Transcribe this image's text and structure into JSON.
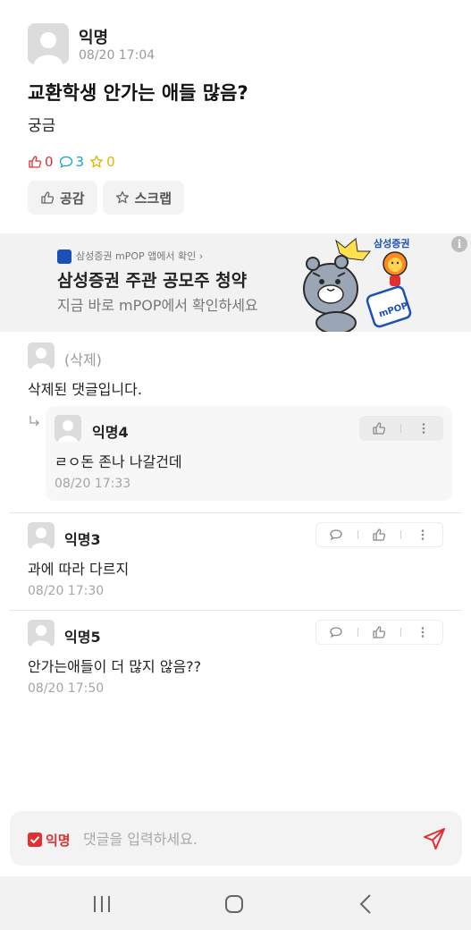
{
  "post": {
    "author": "익명",
    "time": "08/20 17:04",
    "title": "교환학생 안가는 애들 많음?",
    "body": "궁금",
    "like_count": "0",
    "comment_count": "3",
    "scrap_count": "0",
    "like_button_label": "공감",
    "scrap_button_label": "스크랩"
  },
  "ad": {
    "source": "삼성증권 mPOP 앱에서 확인 ›",
    "title": "삼성증권 주관 공모주 청약",
    "subtitle": "지금 바로 mPOP에서 확인하세요",
    "badge": "삼성증권",
    "info_icon": "i"
  },
  "comments": [
    {
      "author": "(삭제)",
      "text": "삭제된 댓글입니다.",
      "replies": [
        {
          "author": "익명4",
          "text": "ㄹㅇ돈 존나 나갈건데",
          "time": "08/20 17:33"
        }
      ]
    },
    {
      "author": "익명3",
      "text": "과에 따라 다르지",
      "time": "08/20 17:30"
    },
    {
      "author": "익명5",
      "text": "안가는애들이 더 많지 않음??",
      "time": "08/20 17:50"
    }
  ],
  "input": {
    "anon_label": "익명",
    "placeholder": "댓글을 입력하세요."
  },
  "colors": {
    "like": "#e03131",
    "comment": "#1aa3c7",
    "scrap": "#e0b400",
    "accent": "#e03131"
  },
  "icons": {
    "like": "thumbs-up-icon",
    "comment": "speech-bubble-icon",
    "scrap": "star-icon",
    "more": "more-vertical-icon",
    "send": "paper-plane-icon",
    "reply": "reply-arrow-icon"
  }
}
